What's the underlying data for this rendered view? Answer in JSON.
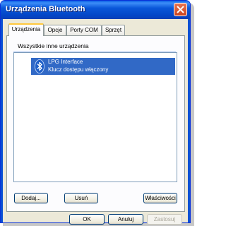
{
  "window": {
    "title": "Urządzenia Bluetooth"
  },
  "tabs": [
    {
      "label": "Urządzenia",
      "active": true
    },
    {
      "label": "Opcje",
      "active": false
    },
    {
      "label": "Porty COM",
      "active": false
    },
    {
      "label": "Sprzęt",
      "active": false
    }
  ],
  "device_list": {
    "group_header": "Wszystkie inne urządzenia",
    "items": [
      {
        "name": "LPG Interface",
        "status": "Klucz dostępu włączony",
        "icon": "bluetooth-icon",
        "selected": true
      }
    ]
  },
  "buttons": {
    "add": "Dodaj...",
    "remove": "Usuń",
    "properties": "Właściwości",
    "ok": "OK",
    "cancel": "Anuluj",
    "apply": "Zastosuj"
  },
  "colors": {
    "titlebar": "#0a57d9",
    "selection": "#3169c6",
    "tab_highlight": "#ffc83c"
  }
}
